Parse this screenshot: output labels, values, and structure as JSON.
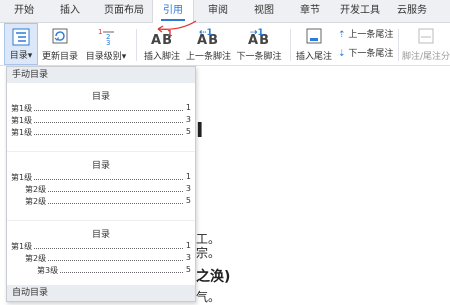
{
  "tabs": [
    "开始",
    "插入",
    "页面布局",
    "引用",
    "审阅",
    "视图",
    "章节",
    "开发工具",
    "云服务"
  ],
  "active_tab": "引用",
  "ribbon": {
    "toc_label": "目录",
    "update_toc_label": "更新目录",
    "toc_level_label": "目录级别",
    "insert_footnote_label": "插入脚注",
    "prev_footnote_label": "上一条脚注",
    "next_footnote_label": "下一条脚注",
    "insert_endnote_label": "插入尾注",
    "prev_endnote_label": "上一条尾注",
    "next_endnote_label": "下一条尾注",
    "footnote_endnote_label": "脚注/尾注分"
  },
  "dropdown": {
    "header": "手动目录",
    "footer": "自动目录",
    "tocs": [
      {
        "title": "目录",
        "rows": [
          {
            "level": "第1级",
            "page": "1"
          },
          {
            "level": "第1级",
            "page": "3"
          },
          {
            "level": "第1级",
            "page": "5"
          }
        ]
      },
      {
        "title": "目录",
        "rows": [
          {
            "level": "第1级",
            "page": "1"
          },
          {
            "level": "第2级",
            "page": "3"
          },
          {
            "level": "第2级",
            "page": "5"
          }
        ]
      },
      {
        "title": "目录",
        "rows": [
          {
            "level": "第1级",
            "page": "1"
          },
          {
            "level": "第2级",
            "page": "3"
          },
          {
            "level": "第3级",
            "page": "5"
          }
        ]
      }
    ]
  },
  "document": {
    "fragment_1": "I",
    "fragment_2": "工。",
    "fragment_3": "宗。",
    "fragment_4": "之涣)",
    "fragment_5": "气。"
  }
}
